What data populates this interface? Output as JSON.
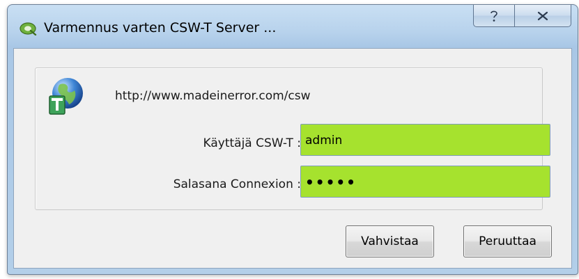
{
  "window": {
    "title": "Varmennus varten CSW-T Server ...",
    "help_glyph": "?",
    "close_glyph": "✕"
  },
  "content": {
    "url": "http://www.madeinerror.com/csw",
    "username_label": "Käyttäjä CSW-T :",
    "username_value": "admin",
    "password_label": "Salasana Connexion :",
    "password_value": "xxxxx"
  },
  "buttons": {
    "ok_label": "Vahvistaa",
    "cancel_label": "Peruuttaa"
  },
  "colors": {
    "field_background": "#a6e22e",
    "titlebar": "#b7d2ec"
  },
  "icons": {
    "app": "qgis-icon",
    "service": "web-service-globe-icon"
  }
}
